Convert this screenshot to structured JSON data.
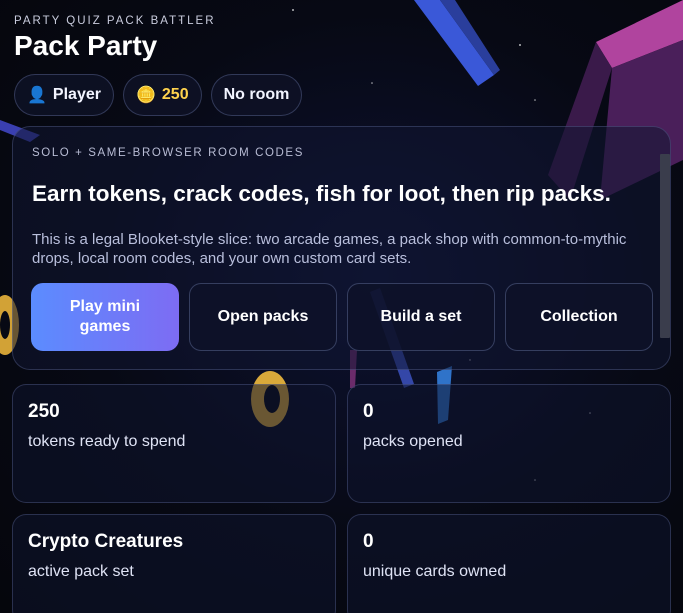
{
  "header": {
    "eyebrow": "PARTY QUIZ PACK BATTLER",
    "title": "Pack Party"
  },
  "chips": {
    "player": {
      "icon": "user-icon",
      "label": "Player"
    },
    "tokens": {
      "icon": "coin-icon",
      "label": "250"
    },
    "room": {
      "label": "No room"
    }
  },
  "hero": {
    "kicker": "SOLO + SAME-BROWSER ROOM CODES",
    "headline": "Earn tokens, crack codes, fish for loot, then rip packs.",
    "description": "This is a legal Blooket-style slice: two arcade games, a pack shop with common-to-mythic drops, local room codes, and your own custom card sets.",
    "actions": [
      {
        "label": "Play mini games"
      },
      {
        "label": "Open packs"
      },
      {
        "label": "Build a set"
      },
      {
        "label": "Collection"
      }
    ]
  },
  "stats": [
    {
      "value": "250",
      "label": "tokens ready to spend"
    },
    {
      "value": "0",
      "label": "packs opened"
    },
    {
      "value": "Crypto Creatures",
      "label": "active pack set"
    },
    {
      "value": "0",
      "label": "unique cards owned"
    }
  ],
  "colors": {
    "background": "#06070f",
    "accent_start": "#5b8cff",
    "accent_end": "#7d6cf3",
    "token_gold": "#ffd34d"
  }
}
